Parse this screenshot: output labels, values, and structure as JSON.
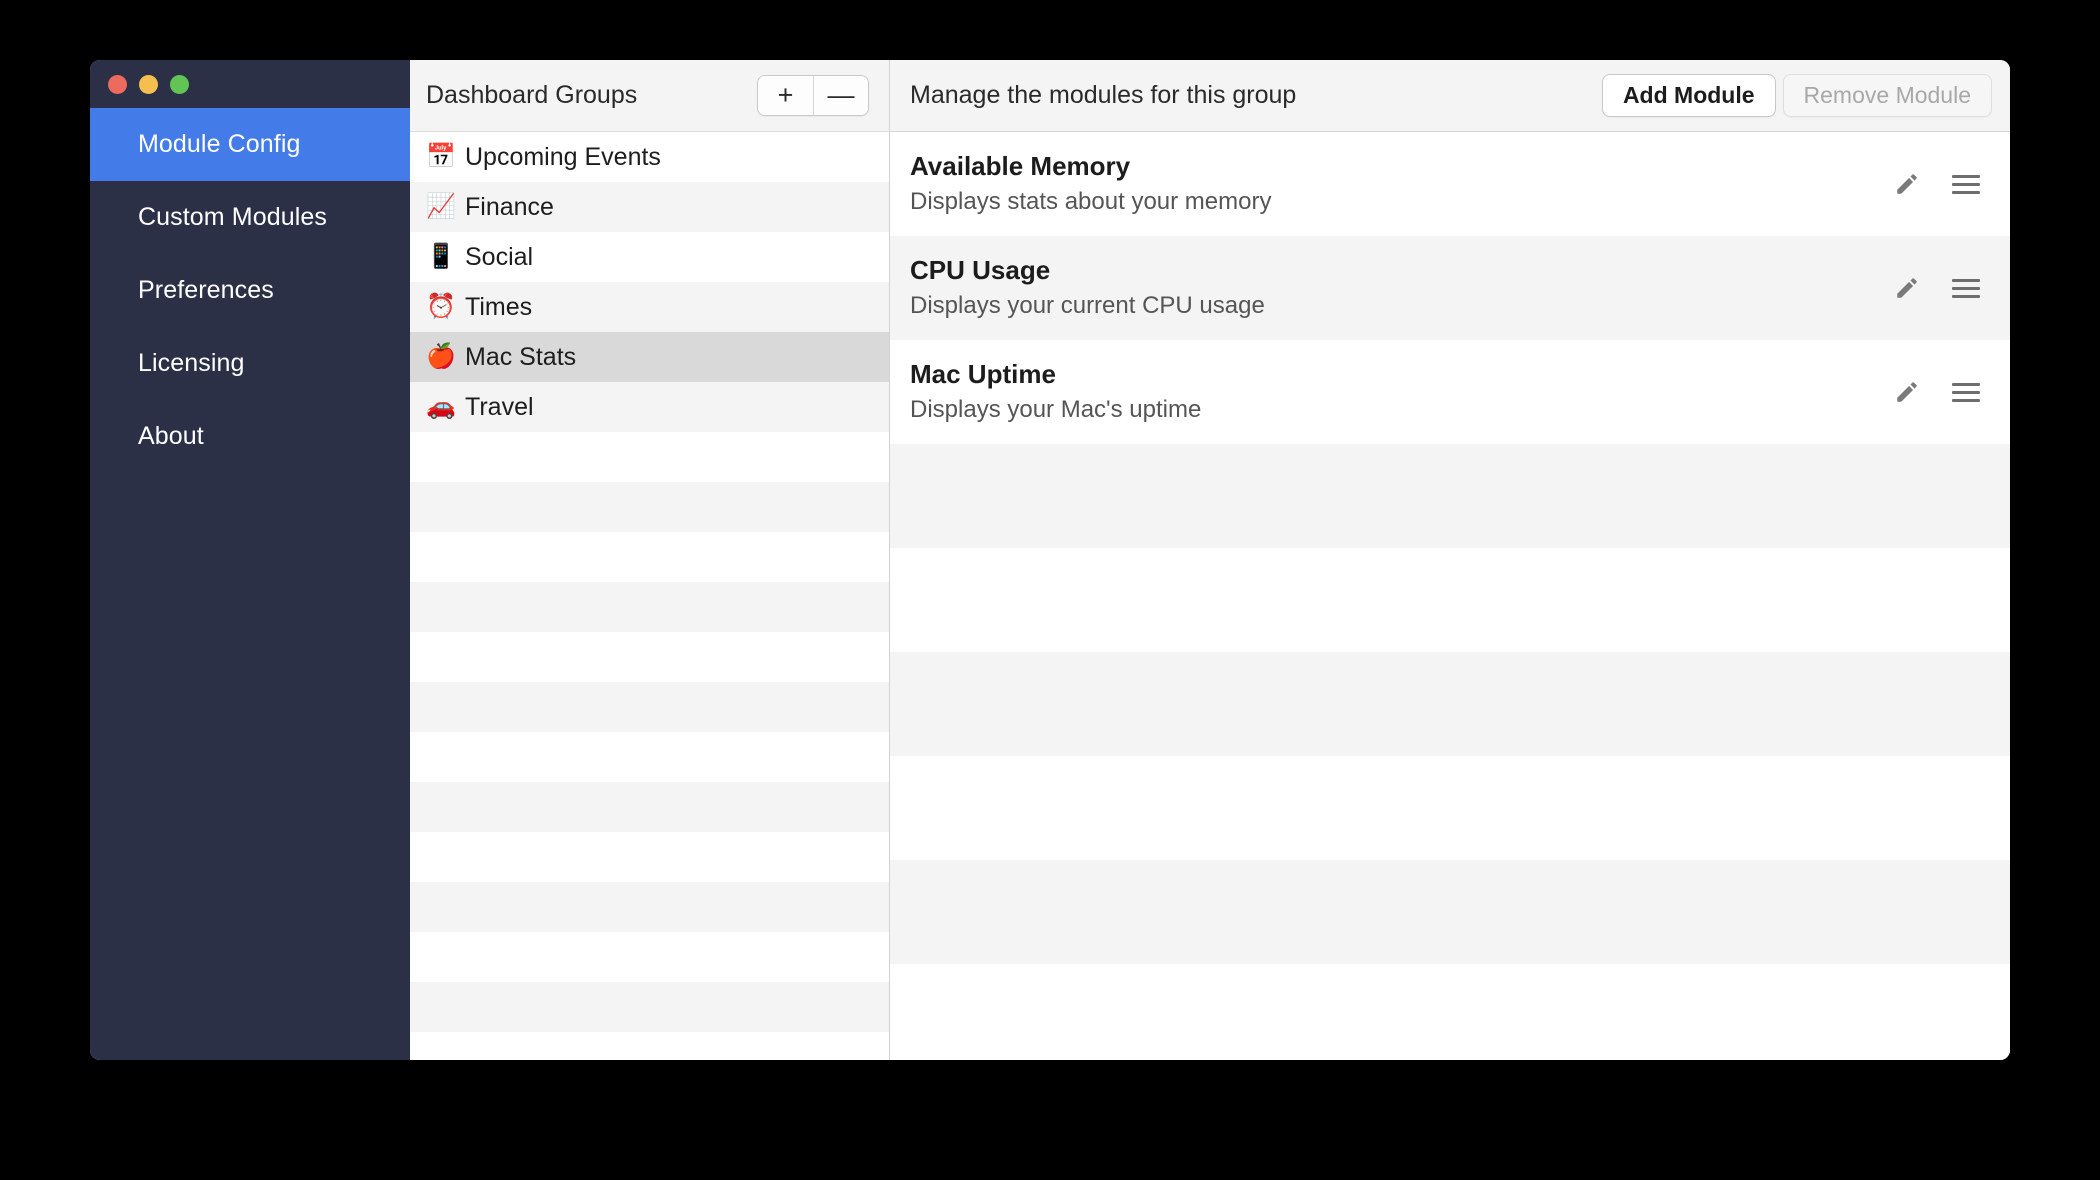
{
  "window": {
    "traffic_lights": [
      {
        "name": "close",
        "color": "#ed6a5e"
      },
      {
        "name": "minimize",
        "color": "#f5bf4f"
      },
      {
        "name": "zoom",
        "color": "#61c454"
      }
    ]
  },
  "sidebar": {
    "items": [
      {
        "label": "Module Config",
        "active": true
      },
      {
        "label": "Custom Modules",
        "active": false
      },
      {
        "label": "Preferences",
        "active": false
      },
      {
        "label": "Licensing",
        "active": false
      },
      {
        "label": "About",
        "active": false
      }
    ],
    "accent_color": "#437be8",
    "background_color": "#2b3047"
  },
  "groups_panel": {
    "title": "Dashboard Groups",
    "add_button_label": "+",
    "remove_button_label": "—",
    "selected_group": "Mac Stats",
    "items": [
      {
        "label": "Upcoming Events",
        "emoji": "📅",
        "icon": "calendar-emoji"
      },
      {
        "label": "Finance",
        "emoji": "📈",
        "icon": "chart-increasing-emoji"
      },
      {
        "label": "Social",
        "emoji": "📱",
        "icon": "mobile-phone-emoji"
      },
      {
        "label": "Times",
        "emoji": "⏰",
        "icon": "alarm-clock-emoji"
      },
      {
        "label": "Mac Stats",
        "emoji": "🍎",
        "icon": "red-apple-emoji"
      },
      {
        "label": "Travel",
        "emoji": "🚗",
        "icon": "car-emoji"
      }
    ],
    "empty_row_count": 13
  },
  "modules_panel": {
    "title": "Manage the modules for this group",
    "add_module_label": "Add Module",
    "remove_module_label": "Remove Module",
    "remove_module_disabled": true,
    "modules": [
      {
        "name": "Available Memory",
        "description": "Displays stats about your memory"
      },
      {
        "name": "CPU Usage",
        "description": "Displays your current CPU usage"
      },
      {
        "name": "Mac Uptime",
        "description": "Displays your Mac's uptime"
      }
    ],
    "empty_row_count": 6
  }
}
